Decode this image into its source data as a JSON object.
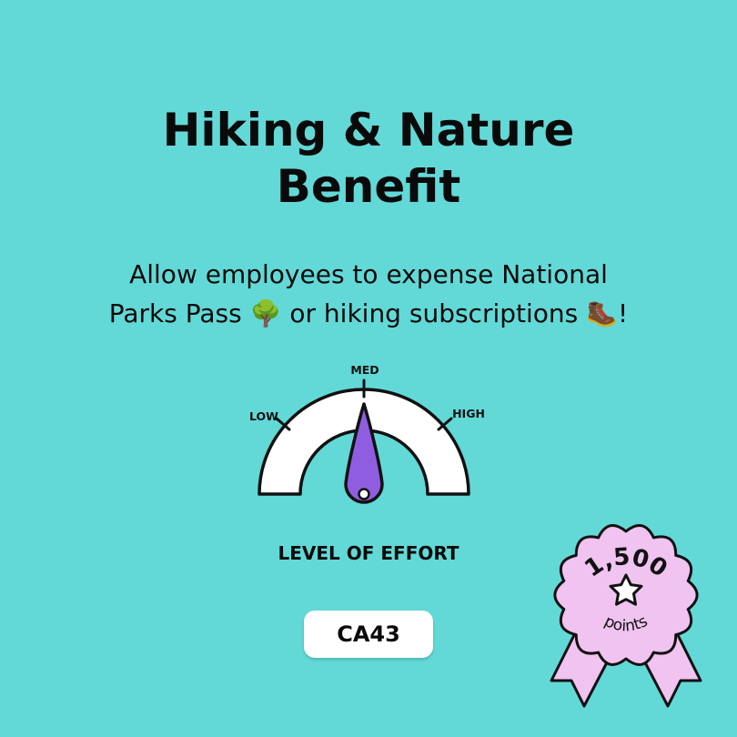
{
  "title": {
    "line1": "Hiking & Nature",
    "line2": "Benefit"
  },
  "subtitle": {
    "line1": "Allow employees to expense National",
    "line2": "Parks Pass 🌳 or hiking subscriptions 🥾!"
  },
  "gauge": {
    "label_low": "LOW",
    "label_med": "MED",
    "label_high": "HIGH",
    "level": "MED",
    "needle_color": "#8f5ee0"
  },
  "effort_label": "LEVEL OF EFFORT",
  "code": "CA43",
  "badge": {
    "points_value": "1,500",
    "points_label": "points",
    "color": "#f0c3f0",
    "icon": "star-icon"
  },
  "colors": {
    "background": "#62d9d7"
  }
}
